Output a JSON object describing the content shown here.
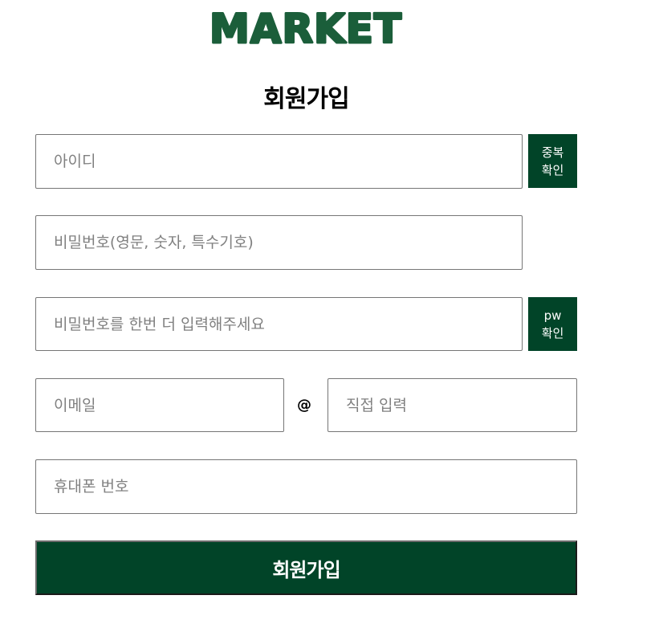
{
  "logo": {
    "text": "MARKET",
    "color": "#1b5e3a"
  },
  "page_title": "회원가입",
  "form": {
    "id_placeholder": "아이디",
    "id_check_button": [
      "중복",
      "확인"
    ],
    "password_placeholder": "비밀번호(영문, 숫자, 특수기호)",
    "password_confirm_placeholder": "비밀번호를 한번 더 입력해주세요",
    "pw_check_button": [
      "pw",
      "확인"
    ],
    "email_placeholder": "이메일",
    "email_at": "@",
    "email_domain_placeholder": "직접 입력",
    "phone_placeholder": "휴대폰 번호",
    "submit_label": "회원가입"
  },
  "colors": {
    "primary": "#014428",
    "border": "#767676",
    "placeholder": "#808080"
  }
}
